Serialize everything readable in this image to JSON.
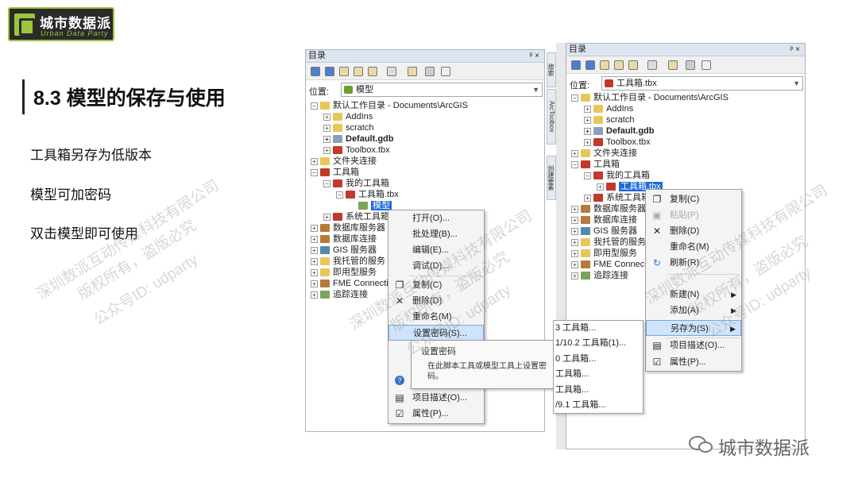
{
  "brand": {
    "cn": "城市数据派",
    "en": "Urban Data Party"
  },
  "title": "8.3 模型的保存与使用",
  "bullets": [
    "工具箱另存为低版本",
    "模型可加密码",
    "双击模型即可使用"
  ],
  "watermark": {
    "line1": "深圳数派互动传媒科技有限公司",
    "line2": "版权所有，盗版必究",
    "line3": "公众号ID: udparty"
  },
  "left": {
    "title": "目录",
    "pin": "ᵖ ×",
    "location_label": "位置:",
    "location_value": "模型",
    "side_tab_1": "搜索",
    "side_tab_2": "ArcToolbox",
    "side_tab_3": "创建要素",
    "tree": {
      "root": "默认工作目录 - Documents\\ArcGIS",
      "addins": "AddIns",
      "scratch": "scratch",
      "default_gdb": "Default.gdb",
      "toolbox": "Toolbox.tbx",
      "folder_conn": "文件夹连接",
      "toolbox_group": "工具箱",
      "my_toolbox": "我的工具箱",
      "tbx": "工具箱.tbx",
      "model": "模型",
      "system_toolbox": "系统工具箱",
      "db_servers": "数据库服务器",
      "db_conn": "数据库连接",
      "gis_servers": "GIS 服务器",
      "my_services": "我托管的服务",
      "ready_services": "即用型服务",
      "fme": "FME Connecti",
      "tracking": "追踪连接"
    },
    "menu": [
      "打开(O)...",
      "批处理(B)...",
      "编辑(E)...",
      "调试(D)...",
      "复制(C)",
      "删除(D)",
      "重命名(M)",
      "设置密码(S)...",
      "设置密码",
      "帮",
      "项目描述(O)...",
      "属性(P)..."
    ],
    "tooltip": "在此脚本工具或模型工具上设置密码。"
  },
  "right": {
    "title": "目录",
    "pin": "ᵖ ×",
    "location_label": "位置:",
    "location_value": "工具箱.tbx",
    "tree": {
      "root": "默认工作目录 - Documents\\ArcGIS",
      "addins": "AddIns",
      "scratch": "scratch",
      "default_gdb": "Default.gdb",
      "toolbox": "Toolbox.tbx",
      "folder_conn": "文件夹连接",
      "toolbox_group": "工具箱",
      "my_toolbox": "我的工具箱",
      "tbx": "工具箱.tbx",
      "system_toolbox": "系统工具箱",
      "db_servers": "数据库服务器",
      "db_conn": "数据库连接",
      "gis_servers": "GIS 服务器",
      "my_services": "我托管的服务",
      "ready_services": "即用型服务",
      "fme": "FME Connec",
      "tracking": "追踪连接"
    },
    "menu": [
      "复制(C)",
      "粘贴(P)",
      "删除(D)",
      "重命名(M)",
      "刷新(R)",
      "新建(N)",
      "添加(A)",
      "另存为(S)",
      "项目描述(O)...",
      "属性(P)..."
    ],
    "submenu": [
      "3 工具箱...",
      "1/10.2 工具箱(1)...",
      "0 工具箱...",
      "工具箱...",
      "工具箱...",
      "/9.1 工具箱..."
    ]
  },
  "footer": "城市数据派"
}
